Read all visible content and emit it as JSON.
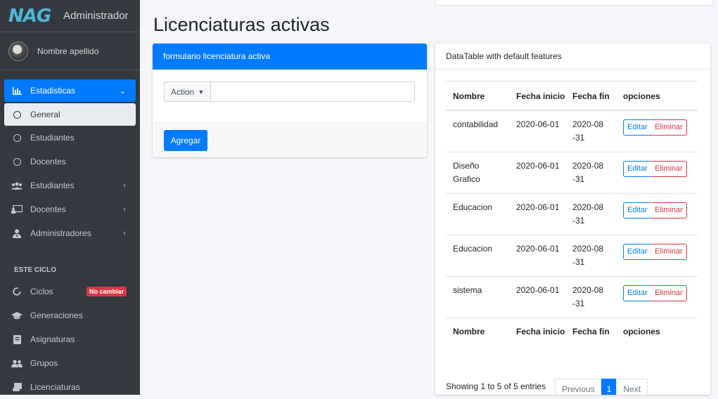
{
  "brand": {
    "logo": "NAG",
    "title": "Administrador"
  },
  "user": {
    "name": "Nombre apellido"
  },
  "sidebar": {
    "menu_statistics": "Estadisticas",
    "sub_items": [
      "General",
      "Estudiantes",
      "Docentes"
    ],
    "items": [
      {
        "label": "Estudiantes",
        "icon": "users-icon"
      },
      {
        "label": "Docentes",
        "icon": "chalkboard-teacher-icon"
      },
      {
        "label": "Administradores",
        "icon": "user-tie-icon"
      }
    ],
    "section_header": "ESTE CICLO",
    "cycle_items": [
      {
        "label": "Ciclos",
        "badge": "No cambiar"
      },
      {
        "label": "Generaciones"
      },
      {
        "label": "Asignaturas"
      },
      {
        "label": "Grupos"
      },
      {
        "label": "Licenciaturas"
      }
    ]
  },
  "page": {
    "title": "Licenciaturas activas"
  },
  "form": {
    "header": "formulario licenciatura activa",
    "dropdown_label": "Action",
    "input_value": "",
    "submit_label": "Agregar"
  },
  "table_card": {
    "header": "DataTable with default features",
    "columns": [
      "Nombre",
      "Fecha inicio",
      "Fecha fin",
      "opciones"
    ],
    "rows": [
      {
        "nombre": "contabilidad",
        "inicio": "2020-06-01",
        "fin": "2020-08-31"
      },
      {
        "nombre": "Diseño Grafico",
        "inicio": "2020-06-01",
        "fin": "2020-08-31"
      },
      {
        "nombre": "Educacion",
        "inicio": "2020-06-01",
        "fin": "2020-08-31"
      },
      {
        "nombre": "Educacion",
        "inicio": "2020-06-01",
        "fin": "2020-08-31"
      },
      {
        "nombre": "sistema",
        "inicio": "2020-06-01",
        "fin": "2020-08-31"
      }
    ],
    "edit_label": "Editar",
    "delete_label": "Eliminar",
    "info": "Showing 1 to 5 of 5 entries",
    "pagination": {
      "previous": "Previous",
      "current": "1",
      "next": "Next"
    }
  },
  "colors": {
    "sidebar": "#343a40",
    "primary": "#007bff",
    "danger": "#dc3545"
  }
}
